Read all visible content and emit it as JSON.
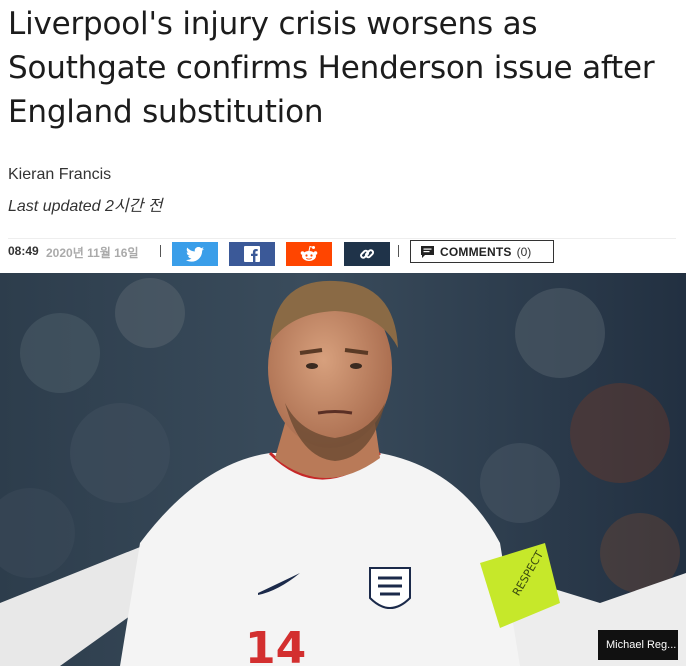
{
  "article": {
    "headline": "Liverpool's injury crisis worsens as Southgate confirms Henderson issue after England substitution",
    "author": "Kieran Francis",
    "last_updated": "Last updated 2시간 전"
  },
  "meta": {
    "time": "08:49",
    "date": "2020년 11월 16일"
  },
  "share": {
    "twitter_icon": "twitter-icon",
    "facebook_icon": "facebook-icon",
    "reddit_icon": "reddit-icon",
    "link_icon": "link-icon",
    "colors": {
      "twitter": "#3a9ee9",
      "facebook": "#3b5998",
      "reddit": "#ff4500",
      "link": "#1f3349"
    }
  },
  "comments": {
    "label": "COMMENTS",
    "count": "(0)"
  },
  "image": {
    "credit": "Michael Reg..."
  }
}
